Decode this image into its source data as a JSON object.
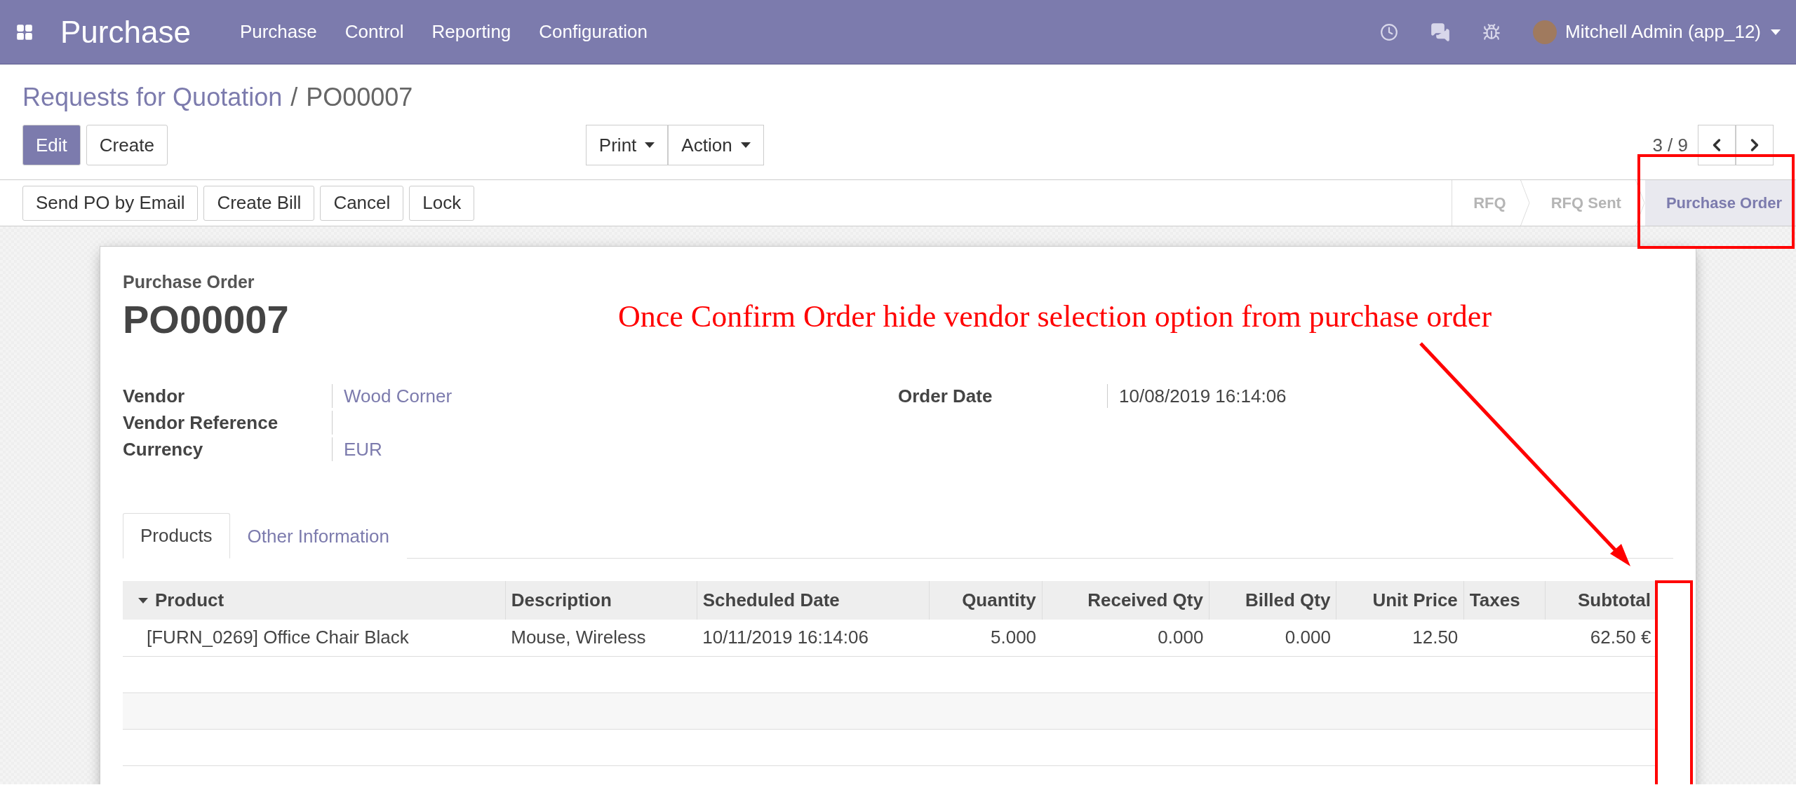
{
  "topbar": {
    "app_title": "Purchase",
    "menu": [
      "Purchase",
      "Control",
      "Reporting",
      "Configuration"
    ],
    "user": "Mitchell Admin (app_12)"
  },
  "breadcrumb_separator": "/",
  "breadcrumb": [
    {
      "label": "Requests for Quotation",
      "link": true
    },
    {
      "label": "PO00007",
      "link": false
    }
  ],
  "control_buttons": [
    {
      "label": "Edit",
      "primary": true
    },
    {
      "label": "Create",
      "primary": false
    }
  ],
  "dropdowns": [
    "Print",
    "Action"
  ],
  "pager": "3 / 9",
  "header_buttons": [
    "Send PO by Email",
    "Create Bill",
    "Cancel",
    "Lock"
  ],
  "stages": [
    {
      "label": "RFQ",
      "selected": false
    },
    {
      "label": "RFQ Sent",
      "selected": false
    },
    {
      "label": "Purchase Order",
      "selected": true
    }
  ],
  "form": {
    "subtitle": "Purchase Order",
    "name": "PO00007",
    "left_fields": [
      {
        "label": "Vendor",
        "value": "Wood Corner"
      },
      {
        "label": "Vendor Reference"
      },
      {
        "label": "Currency",
        "value": "EUR"
      }
    ],
    "right_fields": [
      {
        "label": "Order Date",
        "value": "10/08/2019 16:14:06"
      }
    ]
  },
  "tabs": [
    {
      "label": "Products",
      "selected": true
    },
    {
      "label": "Other Information",
      "selected": false
    }
  ],
  "table": {
    "columns": [
      {
        "label": "Product",
        "kind": "text"
      },
      {
        "label": "Description",
        "kind": "text"
      },
      {
        "label": "Scheduled Date",
        "kind": "text"
      },
      {
        "label": "Quantity",
        "kind": "number"
      },
      {
        "label": "Received Qty",
        "kind": "number"
      },
      {
        "label": "Billed Qty",
        "kind": "number"
      },
      {
        "label": "Unit Price",
        "kind": "number"
      },
      {
        "label": "Taxes",
        "kind": "text"
      },
      {
        "label": "Subtotal",
        "kind": "number"
      }
    ],
    "rows": [
      [
        "[FURN_0269] Office Chair Black",
        "Mouse, Wireless",
        "10/11/2019 16:14:06",
        "5.000",
        "0.000",
        "0.000",
        "12.50",
        "",
        "62.50 €"
      ]
    ]
  },
  "annotation": {
    "text": "Once Confirm Order hide vendor selection option from purchase order"
  }
}
